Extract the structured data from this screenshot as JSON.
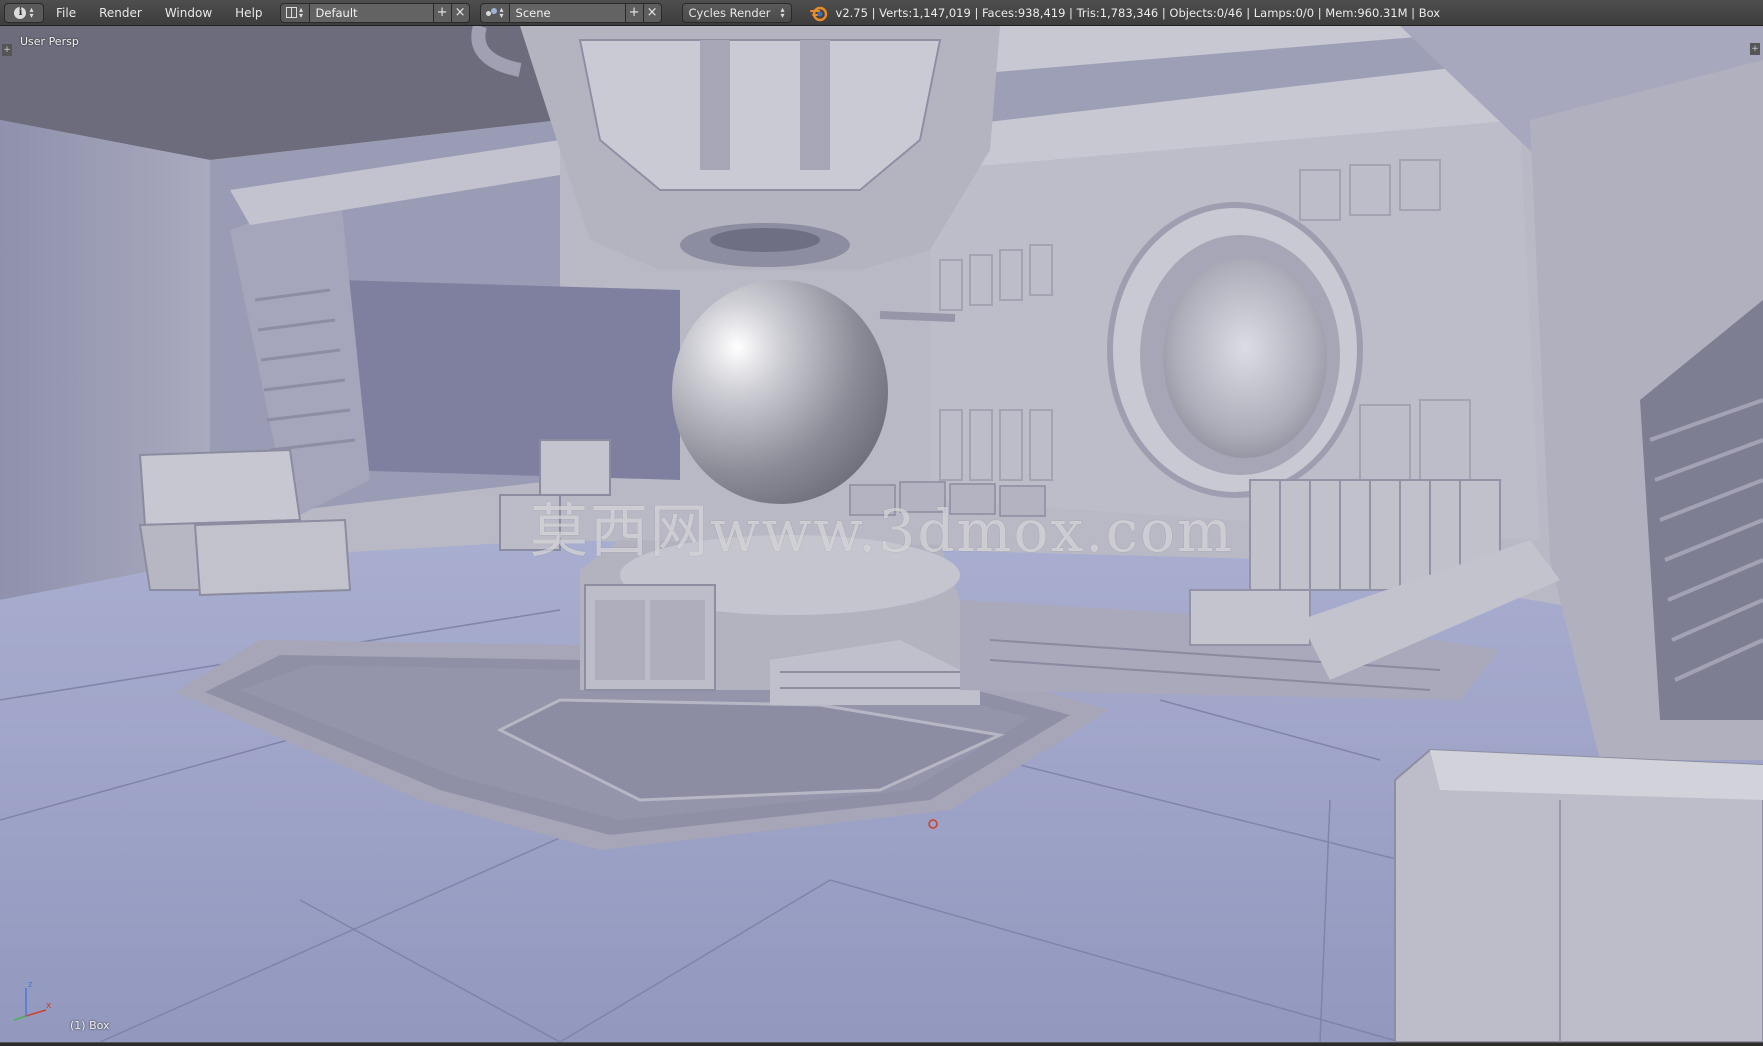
{
  "header": {
    "menus": [
      "File",
      "Render",
      "Window",
      "Help"
    ],
    "screen_layout": "Default",
    "scene_name": "Scene",
    "render_engine": "Cycles Render",
    "stats": "v2.75 | Verts:1,147,019 | Faces:938,419 | Tris:1,783,346 | Objects:0/46 | Lamps:0/0 | Mem:960.31M | Box",
    "add_symbol": "+",
    "close_symbol": "×"
  },
  "viewport": {
    "view_name": "User Persp",
    "active_object": "(1) Box",
    "watermark": "莫西网www.3dmox.com",
    "axis_labels": {
      "x": "x",
      "z": "z"
    }
  },
  "colors": {
    "header_bg": "#474747",
    "floor": "#9da3c4",
    "walls": "#b8b8c6",
    "accent_orange": "#e98b2a"
  }
}
